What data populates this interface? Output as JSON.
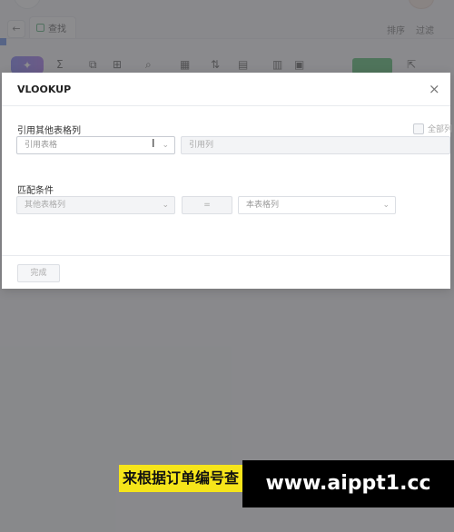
{
  "app": {
    "tab_label": "查找",
    "top_actions": [
      "排序",
      "过滤"
    ],
    "toolbar_icons": [
      "sparkle-icon",
      "sum-icon",
      "copy-icon",
      "grid-icon",
      "search-icon",
      "calendar-icon",
      "swap-icon",
      "table-icon",
      "columns-icon",
      "merge-icon",
      "export-icon"
    ]
  },
  "dialog": {
    "title": "VLOOKUP",
    "section_ref": "引用其他表格列",
    "ref_table_placeholder": "引用表格",
    "ref_column_placeholder": "引用列",
    "select_all_label": "全部列",
    "section_match": "匹配条件",
    "other_column_placeholder": "其他表格列",
    "operator": "=",
    "this_column_placeholder": "本表格列",
    "done_label": "完成"
  },
  "subtitle": "来根据订单编号查",
  "watermark": "www.aippt1.cc"
}
